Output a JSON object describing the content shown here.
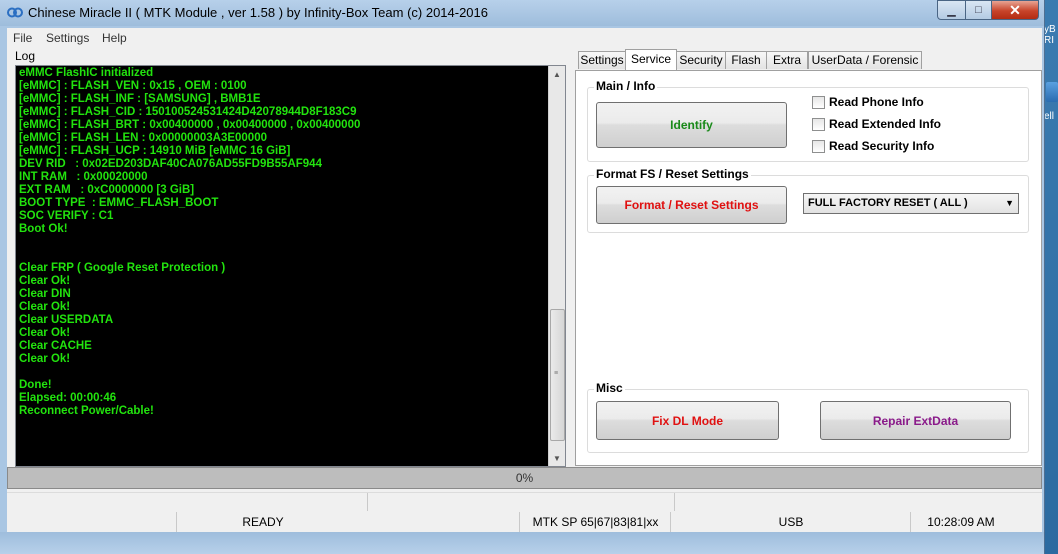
{
  "window": {
    "title": "Chinese Miracle II ( MTK Module , ver 1.58 ) by Infinity-Box Team (c) 2014-2016",
    "minimize_glyph": "▁",
    "maximize_glyph": "□",
    "close_glyph": "✕"
  },
  "desktop_fragments": [
    "yB",
    "RI",
    "ell"
  ],
  "menu": {
    "items": [
      "File",
      "Settings",
      "Help"
    ]
  },
  "log": {
    "label": "Log",
    "lines": [
      "eMMC FlashIC initialized",
      "[eMMC] : FLASH_VEN : 0x15 , OEM : 0100",
      "[eMMC] : FLASH_INF : [SAMSUNG] , BMB1E",
      "[eMMC] : FLASH_CID : 150100524531424D42078944D8F183C9",
      "[eMMC] : FLASH_BRT : 0x00400000 , 0x00400000 , 0x00400000",
      "[eMMC] : FLASH_LEN : 0x00000003A3E00000",
      "[eMMC] : FLASH_UCP : 14910 MiB [eMMC 16 GiB]",
      "DEV RID   : 0x02ED203DAF40CA076AD55FD9B55AF944",
      "INT RAM   : 0x00020000",
      "EXT RAM   : 0xC0000000 [3 GiB]",
      "BOOT TYPE  : EMMC_FLASH_BOOT",
      "SOC VERIFY : C1",
      "Boot Ok!",
      "",
      "",
      "Clear FRP ( Google Reset Protection )",
      "Clear Ok!",
      "Clear DIN",
      "Clear Ok!",
      "Clear USERDATA",
      "Clear Ok!",
      "Clear CACHE",
      "Clear Ok!",
      "",
      "Done!",
      "Elapsed: 00:00:46",
      "Reconnect Power/Cable!"
    ]
  },
  "tabs": [
    {
      "label": "Settings",
      "active": false
    },
    {
      "label": "Service",
      "active": true
    },
    {
      "label": "Security",
      "active": false
    },
    {
      "label": "Flash",
      "active": false
    },
    {
      "label": "Extra",
      "active": false
    },
    {
      "label": "UserData / Forensic",
      "active": false
    }
  ],
  "service": {
    "main_info": {
      "title": "Main / Info",
      "identify_label": "Identify",
      "checkboxes": [
        {
          "label": "Read Phone Info",
          "checked": false
        },
        {
          "label": "Read Extended Info",
          "checked": false
        },
        {
          "label": "Read Security Info",
          "checked": false
        }
      ]
    },
    "format": {
      "title": "Format FS / Reset Settings",
      "button_label": "Format / Reset Settings",
      "select_value": "FULL FACTORY RESET ( ALL )"
    },
    "misc": {
      "title": "Misc",
      "fix_dl_label": "Fix DL Mode",
      "repair_label": "Repair ExtData"
    }
  },
  "colors": {
    "log_text": "#22e30e",
    "identify": "#1a8a1a",
    "format": "#e01010",
    "fix_dl": "#e01010",
    "repair": "#8a1a8a"
  },
  "progress": {
    "text": "0%"
  },
  "status": {
    "state": "READY",
    "chipset": "MTK SP 65|67|83|81|xx",
    "connection": "USB",
    "time": "10:28:09 AM"
  }
}
